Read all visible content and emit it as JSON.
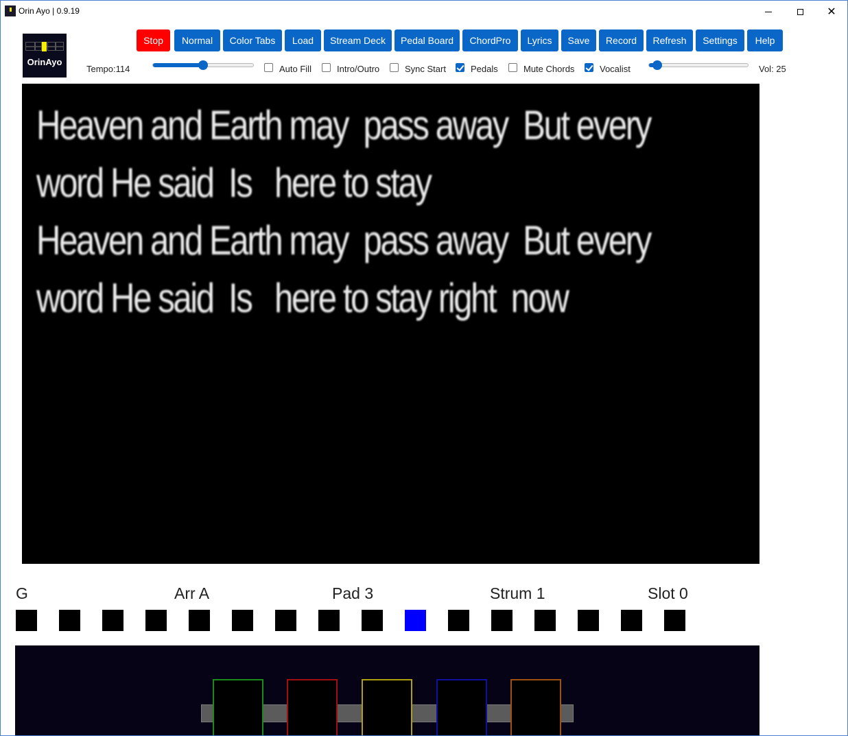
{
  "window": {
    "title": "Orin Ayo | 0.9.19"
  },
  "logo": {
    "text": "OrinAyo"
  },
  "toolbar": {
    "buttons": [
      {
        "label": "Stop"
      },
      {
        "label": "Normal"
      },
      {
        "label": "Color Tabs"
      },
      {
        "label": "Load"
      },
      {
        "label": "Stream Deck"
      },
      {
        "label": "Pedal Board"
      },
      {
        "label": "ChordPro"
      },
      {
        "label": "Lyrics"
      },
      {
        "label": "Save"
      },
      {
        "label": "Record"
      },
      {
        "label": "Refresh"
      },
      {
        "label": "Settings"
      },
      {
        "label": "Help"
      }
    ]
  },
  "controls": {
    "tempo_label": "Tempo:114",
    "tempo_slider_fraction": 0.5,
    "checkboxes": [
      {
        "label": "Auto Fill",
        "checked": false
      },
      {
        "label": "Intro/Outro",
        "checked": false
      },
      {
        "label": "Sync Start",
        "checked": false
      },
      {
        "label": "Pedals",
        "checked": true
      },
      {
        "label": "Mute Chords",
        "checked": false
      },
      {
        "label": "Vocalist",
        "checked": true
      }
    ],
    "volume_slider_fraction": 0.04,
    "volume_label": "Vol: 25"
  },
  "lyrics": {
    "lines": [
      "Heaven and Earth may  pass away  But every",
      "word He said  Is   here to stay",
      "Heaven and Earth may  pass away  But every",
      "word He said  Is   here to stay right  now"
    ]
  },
  "status": {
    "chord": "G",
    "arrangement": "Arr A",
    "pad": "Pad 3",
    "strum": "Strum 1",
    "slot": "Slot 0"
  },
  "pads": {
    "count": 16,
    "active_index": 9,
    "active_color": "#0000ff",
    "inactive_color": "#000000"
  },
  "pedalboard": {
    "pedal_colors": [
      "#1a8a1a",
      "#a01010",
      "#b0a010",
      "#1010a0",
      "#a05010"
    ]
  }
}
